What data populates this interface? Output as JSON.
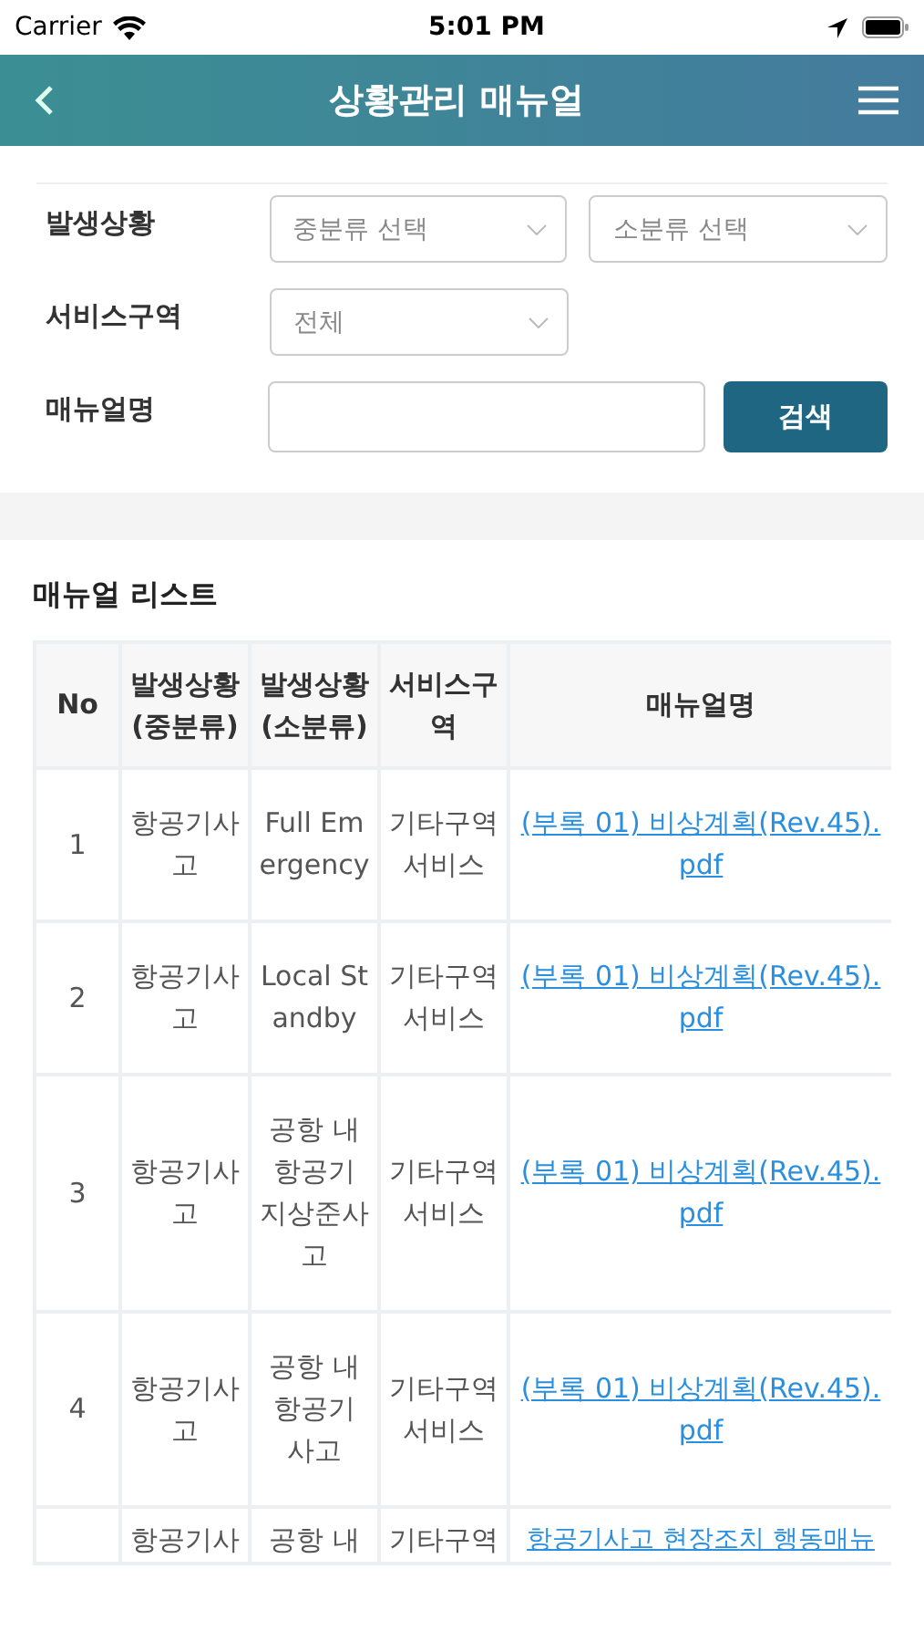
{
  "status_bar": {
    "carrier": "Carrier",
    "time": "5:01 PM"
  },
  "header": {
    "title": "상황관리 매뉴얼"
  },
  "filters": [
    {
      "label": "발생상황",
      "kind": "select",
      "fields": [
        {
          "placeholder": "중분류 선택"
        },
        {
          "placeholder": "소분류 선택"
        }
      ]
    },
    {
      "label": "서비스구역",
      "kind": "select",
      "fields": [
        {
          "placeholder": "전체"
        }
      ]
    },
    {
      "label": "매뉴얼명",
      "kind": "search",
      "button": "검색"
    }
  ],
  "table": {
    "title": "매뉴얼 리스트",
    "columns": [
      "No",
      "발생상황(중분류)",
      "발생상황(소분류)",
      "서비스구역",
      "매뉴얼명"
    ],
    "rows": [
      {
        "cells": [
          "1",
          "항공기사고",
          "Full Emergency",
          "기타구역 서비스",
          "(부록 01) 비상계획(Rev.45).pdf"
        ]
      },
      {
        "cells": [
          "2",
          "항공기사고",
          "Local Standby",
          "기타구역 서비스",
          "(부록 01) 비상계획(Rev.45).pdf"
        ]
      },
      {
        "cells": [
          "3",
          "항공기사고",
          "공항 내 항공기 지상준사고",
          "기타구역 서비스",
          "(부록 01) 비상계획(Rev.45).pdf"
        ]
      },
      {
        "cells": [
          "4",
          "항공기사고",
          "공항 내 항공기 사고",
          "기타구역 서비스",
          "(부록 01) 비상계획(Rev.45).pdf"
        ]
      },
      {
        "cells": [
          "",
          "항공기사",
          "공항 내",
          "기타구역",
          "항공기사고 현장조치 행동매뉴"
        ]
      }
    ]
  }
}
